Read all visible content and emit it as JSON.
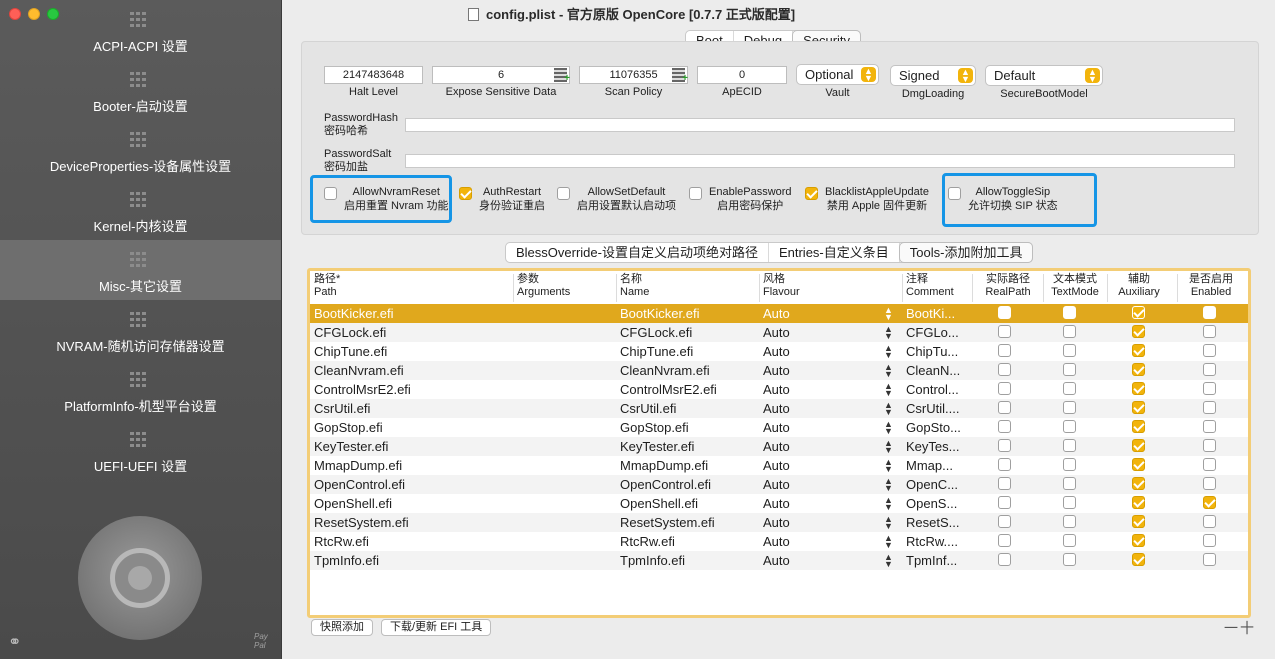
{
  "window": {
    "title": "config.plist - 官方原版 OpenCore [0.7.7 正式版配置]"
  },
  "sidebar": {
    "items": [
      {
        "label": "ACPI-ACPI 设置"
      },
      {
        "label": "Booter-启动设置"
      },
      {
        "label": "DeviceProperties-设备属性设置"
      },
      {
        "label": "Kernel-内核设置"
      },
      {
        "label": "Misc-其它设置",
        "active": true
      },
      {
        "label": "NVRAM-随机访问存储器设置"
      },
      {
        "label": "PlatformInfo-机型平台设置"
      },
      {
        "label": "UEFI-UEFI 设置"
      }
    ],
    "paypal": [
      "Pay",
      "Pal"
    ]
  },
  "top_tabs": [
    {
      "label": "Boot"
    },
    {
      "label": "Debug"
    },
    {
      "label": "Security",
      "selected": true
    }
  ],
  "security": {
    "halt_level": {
      "value": "2147483648",
      "label": "Halt Level"
    },
    "expose_sensitive_data": {
      "value": "6",
      "label": "Expose Sensitive Data"
    },
    "scan_policy": {
      "value": "11076355",
      "label": "Scan Policy"
    },
    "apecid": {
      "value": "0",
      "label": "ApECID"
    },
    "vault": {
      "value": "Optional",
      "label": "Vault"
    },
    "dmg_loading": {
      "value": "Signed",
      "label": "DmgLoading"
    },
    "secure_boot_model": {
      "value": "Default",
      "label": "SecureBootModel"
    },
    "password_hash": {
      "label1": "PasswordHash",
      "label2": "密码哈希",
      "value": ""
    },
    "password_salt": {
      "label1": "PasswordSalt",
      "label2": "密码加盐",
      "value": ""
    },
    "options": [
      {
        "name": "AllowNvramReset",
        "desc": "启用重置 Nvram 功能",
        "checked": false
      },
      {
        "name": "AuthRestart",
        "desc": "身份验证重启",
        "checked": true
      },
      {
        "name": "AllowSetDefault",
        "desc": "启用设置默认启动项",
        "checked": false
      },
      {
        "name": "EnablePassword",
        "desc": "启用密码保护",
        "checked": false
      },
      {
        "name": "BlacklistAppleUpdate",
        "desc": "禁用 Apple 固件更新",
        "checked": true
      },
      {
        "name": "AllowToggleSip",
        "desc": "允许切换 SIP 状态",
        "checked": false
      }
    ],
    "highlight_color": "#1595e6"
  },
  "sub_tabs": [
    {
      "label": "BlessOverride-设置自定义启动项绝对路径"
    },
    {
      "label": "Entries-自定义条目"
    },
    {
      "label": "Tools-添加附加工具",
      "selected": true
    }
  ],
  "tools_table": {
    "headers": [
      {
        "zh": "路径*",
        "en": "Path"
      },
      {
        "zh": "参数",
        "en": "Arguments"
      },
      {
        "zh": "名称",
        "en": "Name"
      },
      {
        "zh": "风格",
        "en": "Flavour"
      },
      {
        "zh": "注释",
        "en": "Comment"
      },
      {
        "zh": "实际路径",
        "en": "RealPath"
      },
      {
        "zh": "文本模式",
        "en": "TextMode"
      },
      {
        "zh": "辅助",
        "en": "Auxiliary"
      },
      {
        "zh": "是否启用",
        "en": "Enabled"
      }
    ],
    "rows": [
      {
        "path": "BootKicker.efi",
        "arguments": "",
        "name": "BootKicker.efi",
        "flavour": "Auto",
        "comment": "BootKi...",
        "realpath": false,
        "textmode": false,
        "auxiliary": true,
        "enabled": false
      },
      {
        "path": "CFGLock.efi",
        "arguments": "",
        "name": "CFGLock.efi",
        "flavour": "Auto",
        "comment": "CFGLo...",
        "realpath": false,
        "textmode": false,
        "auxiliary": true,
        "enabled": false
      },
      {
        "path": "ChipTune.efi",
        "arguments": "",
        "name": "ChipTune.efi",
        "flavour": "Auto",
        "comment": "ChipTu...",
        "realpath": false,
        "textmode": false,
        "auxiliary": true,
        "enabled": false
      },
      {
        "path": "CleanNvram.efi",
        "arguments": "",
        "name": "CleanNvram.efi",
        "flavour": "Auto",
        "comment": "CleanN...",
        "realpath": false,
        "textmode": false,
        "auxiliary": true,
        "enabled": false
      },
      {
        "path": "ControlMsrE2.efi",
        "arguments": "",
        "name": "ControlMsrE2.efi",
        "flavour": "Auto",
        "comment": "Control...",
        "realpath": false,
        "textmode": false,
        "auxiliary": true,
        "enabled": false
      },
      {
        "path": "CsrUtil.efi",
        "arguments": "",
        "name": "CsrUtil.efi",
        "flavour": "Auto",
        "comment": "CsrUtil....",
        "realpath": false,
        "textmode": false,
        "auxiliary": true,
        "enabled": false
      },
      {
        "path": "GopStop.efi",
        "arguments": "",
        "name": "GopStop.efi",
        "flavour": "Auto",
        "comment": "GopSto...",
        "realpath": false,
        "textmode": false,
        "auxiliary": true,
        "enabled": false
      },
      {
        "path": "KeyTester.efi",
        "arguments": "",
        "name": "KeyTester.efi",
        "flavour": "Auto",
        "comment": "KeyTes...",
        "realpath": false,
        "textmode": false,
        "auxiliary": true,
        "enabled": false
      },
      {
        "path": "MmapDump.efi",
        "arguments": "",
        "name": "MmapDump.efi",
        "flavour": "Auto",
        "comment": "Mmap...",
        "realpath": false,
        "textmode": false,
        "auxiliary": true,
        "enabled": false
      },
      {
        "path": "OpenControl.efi",
        "arguments": "",
        "name": "OpenControl.efi",
        "flavour": "Auto",
        "comment": "OpenC...",
        "realpath": false,
        "textmode": false,
        "auxiliary": true,
        "enabled": false
      },
      {
        "path": "OpenShell.efi",
        "arguments": "",
        "name": "OpenShell.efi",
        "flavour": "Auto",
        "comment": "OpenS...",
        "realpath": false,
        "textmode": false,
        "auxiliary": true,
        "enabled": true
      },
      {
        "path": "ResetSystem.efi",
        "arguments": "",
        "name": "ResetSystem.efi",
        "flavour": "Auto",
        "comment": "ResetS...",
        "realpath": false,
        "textmode": false,
        "auxiliary": true,
        "enabled": false
      },
      {
        "path": "RtcRw.efi",
        "arguments": "",
        "name": "RtcRw.efi",
        "flavour": "Auto",
        "comment": "RtcRw....",
        "realpath": false,
        "textmode": false,
        "auxiliary": true,
        "enabled": false
      },
      {
        "path": "TpmInfo.efi",
        "arguments": "",
        "name": "TpmInfo.efi",
        "flavour": "Auto",
        "comment": "TpmInf...",
        "realpath": false,
        "textmode": false,
        "auxiliary": true,
        "enabled": false
      }
    ],
    "selected_row_color": "#e0a81d",
    "frame_color": "#f3cd76"
  },
  "footer": {
    "snapshot_add": "快照添加",
    "download_update": "下载/更新 EFI 工具",
    "add_remove": "一十"
  },
  "colors": {
    "accent": "#f2b40c",
    "sidebar_bg": "#4f4f4f"
  }
}
